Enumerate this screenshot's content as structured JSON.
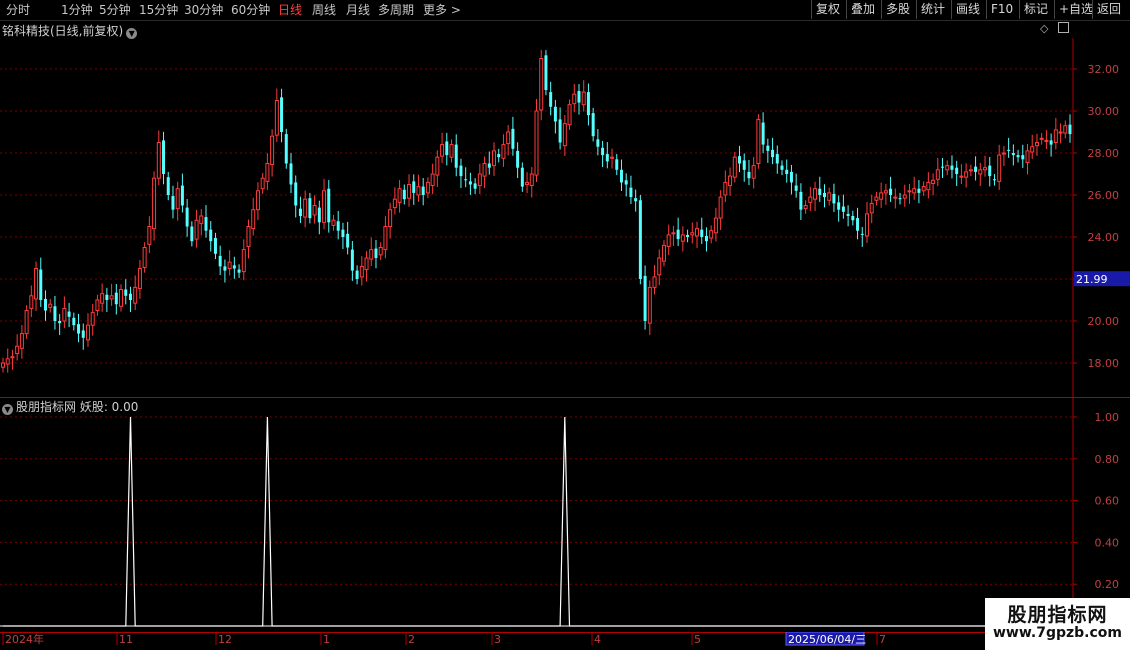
{
  "toolbar": {
    "periods": [
      "分时",
      "1分钟",
      "5分钟",
      "15分钟",
      "30分钟",
      "60分钟",
      "日线",
      "周线",
      "月线",
      "多周期",
      "更多 >"
    ],
    "active_period": "日线",
    "buttons": [
      "复权",
      "叠加",
      "多股",
      "统计",
      "画线",
      "F10",
      "标记",
      "+自选",
      "返回"
    ]
  },
  "main_chart": {
    "title": "铭科精技(日线,前复权)",
    "icons": [
      "dropdown-icon",
      "diamond-icon",
      "panel-toggle-icon"
    ],
    "y_ticks": [
      "32.00",
      "30.00",
      "28.00",
      "26.00",
      "24.00",
      "22.00",
      "20.00",
      "18.00"
    ],
    "current_price": "21.99"
  },
  "indicator": {
    "label": "股朋指标网 妖股: 0.00",
    "y_ticks": [
      "1.00",
      "0.80",
      "0.60",
      "0.40",
      "0.20"
    ]
  },
  "time_axis": {
    "labels": [
      "2024年",
      "11",
      "12",
      "1",
      "2",
      "3",
      "4",
      "5",
      "6",
      "7"
    ],
    "cursor_date": "2025/06/04/三"
  },
  "watermark": {
    "line1": "股朋指标网",
    "line2": "www.7gpzb.com"
  },
  "colors": {
    "up": "#ff3b3b",
    "down": "#54ffff",
    "grid": "#7a0000",
    "axis": "#b00000",
    "active": "#ff4040",
    "price_tag": "#1a1aa8"
  },
  "chart_data": {
    "type": "candlestick",
    "title": "铭科精技(日线,前复权)",
    "ylim": [
      17,
      33.5
    ],
    "close_series": [
      18.0,
      18.2,
      18.3,
      18.8,
      19.4,
      20.5,
      21.2,
      22.5,
      21.0,
      20.5,
      20.8,
      20.0,
      19.9,
      20.6,
      20.2,
      19.8,
      19.4,
      19.2,
      19.8,
      20.4,
      21.0,
      21.3,
      21.0,
      21.2,
      20.8,
      21.5,
      21.2,
      21.0,
      21.6,
      22.5,
      23.5,
      24.5,
      26.8,
      28.5,
      27.0,
      26.0,
      25.3,
      26.3,
      25.5,
      24.5,
      23.8,
      24.8,
      25.0,
      24.3,
      23.8,
      23.2,
      22.6,
      22.4,
      22.8,
      22.5,
      22.3,
      23.4,
      24.5,
      25.3,
      26.2,
      26.8,
      27.5,
      28.8,
      30.5,
      29.0,
      27.5,
      26.5,
      25.5,
      25.0,
      25.8,
      24.9,
      25.5,
      24.7,
      26.2,
      24.7,
      24.8,
      24.3,
      24.0,
      23.5,
      22.4,
      22.0,
      22.6,
      23.0,
      23.4,
      23.0,
      23.5,
      24.5,
      25.3,
      25.8,
      26.3,
      25.8,
      26.5,
      26.1,
      26.4,
      26.0,
      26.6,
      27.0,
      27.8,
      28.4,
      27.9,
      28.4,
      27.3,
      26.9,
      26.7,
      26.5,
      26.3,
      27.0,
      27.5,
      27.3,
      28.1,
      27.8,
      28.4,
      29.0,
      28.2,
      27.3,
      26.4,
      26.6,
      27.0,
      30.0,
      32.5,
      31.0,
      30.2,
      29.5,
      28.5,
      29.4,
      30.3,
      30.8,
      30.4,
      30.9,
      29.8,
      28.8,
      28.3,
      27.9,
      27.6,
      27.8,
      27.2,
      26.6,
      26.5,
      25.9,
      25.7,
      22.0,
      20.0,
      21.6,
      22.1,
      23.0,
      23.6,
      24.1,
      24.2,
      23.9,
      24.1,
      24.0,
      24.2,
      24.4,
      24.0,
      23.8,
      24.3,
      24.9,
      25.9,
      26.6,
      26.9,
      27.8,
      27.5,
      27.2,
      26.8,
      27.4,
      29.6,
      28.4,
      28.1,
      27.8,
      27.5,
      27.2,
      27.0,
      26.6,
      26.2,
      25.3,
      25.5,
      25.9,
      26.3,
      26.0,
      25.9,
      26.1,
      25.6,
      25.3,
      25.2,
      25.0,
      24.8,
      24.3,
      24.1,
      25.1,
      25.6,
      25.9,
      26.1,
      26.2,
      26.0,
      25.9,
      25.8,
      26.0,
      26.2,
      26.3,
      26.1,
      26.4,
      26.6,
      26.7,
      27.2,
      27.3,
      27.4,
      27.2,
      27.0,
      26.9,
      27.1,
      27.2,
      27.1,
      27.2,
      27.3,
      26.9,
      26.7,
      27.9,
      28.0,
      28.1,
      27.9,
      27.8,
      27.7,
      28.1,
      28.3,
      28.5,
      28.7,
      28.6,
      28.4,
      29.1,
      29.0,
      29.3,
      28.9
    ],
    "indicator_name": "妖股",
    "indicator_signals_at_index": [
      27,
      56,
      119
    ],
    "indicator_ylim": [
      0,
      1.05
    ]
  }
}
